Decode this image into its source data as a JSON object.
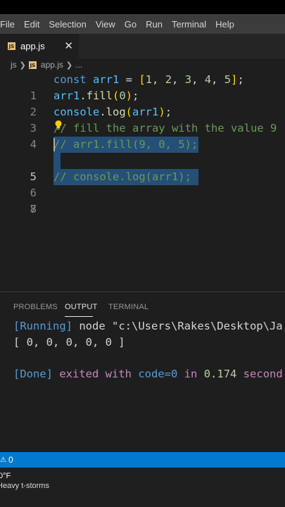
{
  "menubar": [
    "File",
    "Edit",
    "Selection",
    "View",
    "Go",
    "Run",
    "Terminal",
    "Help"
  ],
  "tab": {
    "icon": "js-file-icon",
    "label": "app.js",
    "close": "✕"
  },
  "breadcrumb": {
    "folder": "js",
    "file": "app.js",
    "more": "..."
  },
  "editor": {
    "line_numbers": [
      "1",
      "2",
      "3",
      "4",
      "5",
      "6",
      "7",
      "8"
    ],
    "active_line": "5"
  },
  "panel": {
    "tabs": [
      "PROBLEMS",
      "OUTPUT",
      "TERMINAL"
    ],
    "active_tab": "OUTPUT",
    "running_tag": "[Running]",
    "running_cmd": "node \"c:\\Users\\Rakes\\Desktop\\Ja",
    "result": "[ 0, 0, 0, 0, 0 ]",
    "done_tag": "[Done]",
    "done_text": "exited with",
    "done_code": "code=0",
    "done_in": "in",
    "done_time": "0.174",
    "done_unit": "second"
  },
  "status": {
    "warnings": "0",
    "warn_icon": "warning-icon"
  },
  "taskbar": {
    "temperature": "0°F",
    "weather": "Heavy t-storms"
  },
  "colors": {
    "menubar": "#3c3c3c",
    "editor_bg": "#1e1e1e",
    "statusbar": "#007acc",
    "selection": "#264f78"
  }
}
